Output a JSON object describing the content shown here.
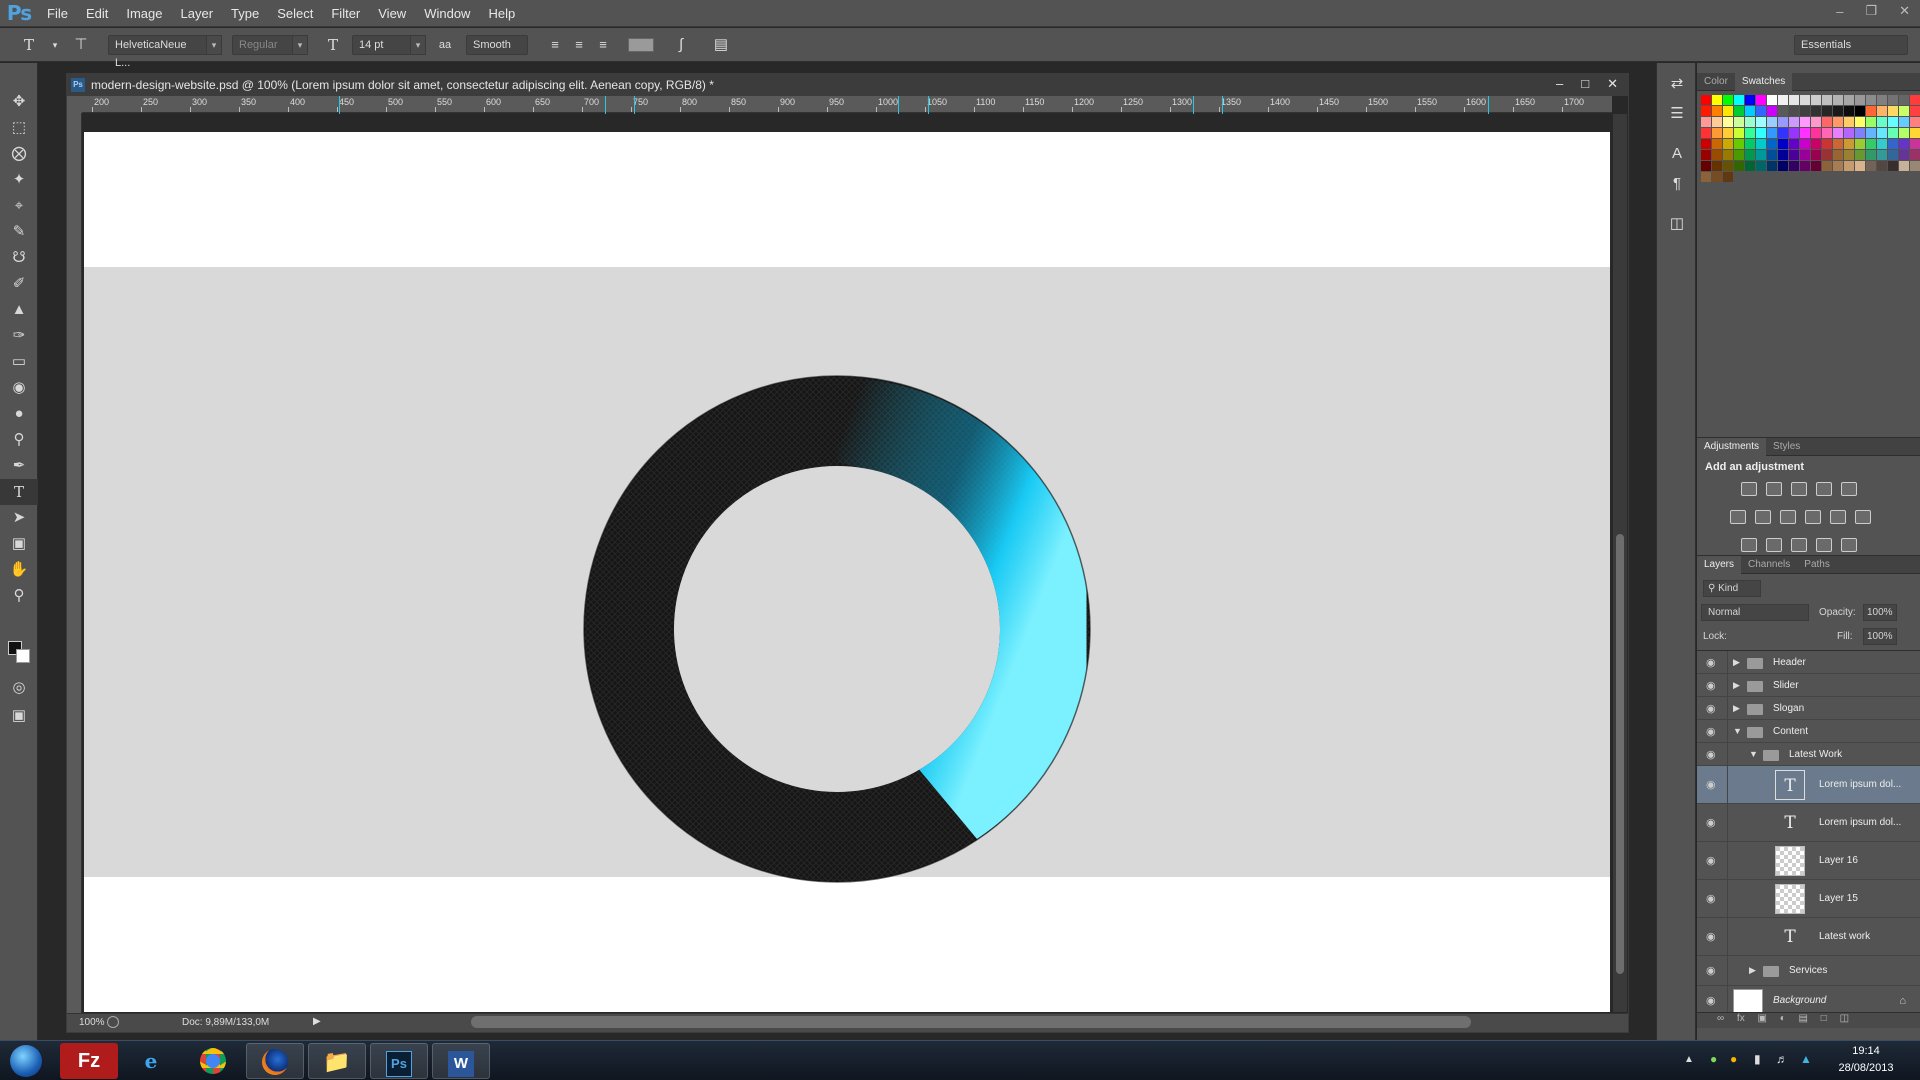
{
  "app": {
    "logo": "Ps",
    "menu": [
      "File",
      "Edit",
      "Image",
      "Layer",
      "Type",
      "Select",
      "Filter",
      "View",
      "Window",
      "Help"
    ],
    "workspace": "Essentials"
  },
  "options": {
    "font_family": "HelveticaNeue L...",
    "font_style": "Regular",
    "font_size": "14 pt",
    "antialias": "Smooth"
  },
  "document": {
    "title": "modern-design-website.psd @ 100% (Lorem ipsum dolor sit amet, consectetur adipiscing elit. Aenean copy, RGB/8) *",
    "zoom": "100%",
    "doc_size": "Doc: 9,89M/133,0M",
    "ruler_marks": [
      "200",
      "250",
      "300",
      "350",
      "400",
      "450",
      "500",
      "550",
      "600",
      "650",
      "700",
      "750",
      "800",
      "850",
      "900",
      "950",
      "1000",
      "1050",
      "1100",
      "1150",
      "1200",
      "1250",
      "1300",
      "1350",
      "1400",
      "1450",
      "1500",
      "1550",
      "1600",
      "1650",
      "1700"
    ],
    "ring_accent": "#19d3ff",
    "ring_dark": "#1a1a1a",
    "band_color": "#d9d9d9"
  },
  "panels": {
    "color_tabs": [
      "Color",
      "Swatches"
    ],
    "adjust_tabs": [
      "Adjustments",
      "Styles"
    ],
    "adjust_title": "Add an adjustment",
    "layers_tabs": [
      "Layers",
      "Channels",
      "Paths"
    ],
    "kind": "Kind",
    "blend_mode": "Normal",
    "opacity_label": "Opacity:",
    "opacity_value": "100%",
    "lock_label": "Lock:",
    "fill_label": "Fill:",
    "fill_value": "100%",
    "layers": [
      {
        "name": "Header",
        "type": "group",
        "indent": 0,
        "expanded": false
      },
      {
        "name": "Slider",
        "type": "group",
        "indent": 0,
        "expanded": false
      },
      {
        "name": "Slogan",
        "type": "group",
        "indent": 0,
        "expanded": false
      },
      {
        "name": "Content",
        "type": "group",
        "indent": 0,
        "expanded": true
      },
      {
        "name": "Latest Work",
        "type": "group",
        "indent": 1,
        "expanded": true
      },
      {
        "name": "Lorem ipsum dol...",
        "type": "text",
        "indent": 2,
        "selected": true
      },
      {
        "name": "Lorem ipsum dol...",
        "type": "text",
        "indent": 2
      },
      {
        "name": "Layer 16",
        "type": "pixel",
        "indent": 2
      },
      {
        "name": "Layer 15",
        "type": "pixel",
        "indent": 2
      },
      {
        "name": "Latest work",
        "type": "text",
        "indent": 2
      },
      {
        "name": "Services",
        "type": "group",
        "indent": 1,
        "expanded": false
      },
      {
        "name": "Background",
        "type": "background",
        "indent": 0
      }
    ]
  },
  "taskbar": {
    "apps": [
      "Start",
      "FileZilla",
      "Internet Explorer",
      "Chrome",
      "Firefox",
      "File Explorer",
      "Photoshop",
      "Word"
    ],
    "time": "19:14",
    "date": "28/08/2013"
  }
}
